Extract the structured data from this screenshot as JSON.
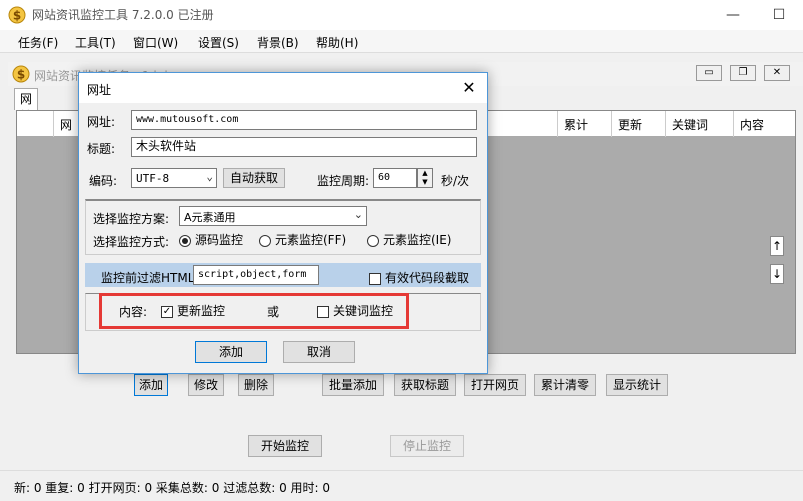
{
  "window": {
    "title": "网站资讯监控工具 7.2.0.0   已注册",
    "minimize": "—",
    "maximize": "☐"
  },
  "menu": [
    "任务(F)",
    "工具(T)",
    "窗口(W)",
    "设置(S)",
    "背景(B)",
    "帮助(H)"
  ],
  "child": {
    "title": "网站资讯监控任务 - 1.ini",
    "min": "▭",
    "restore": "❐",
    "close": "✕"
  },
  "tab": {
    "label": "网址管理"
  },
  "grid": {
    "columns": [
      "",
      "网",
      "",
      "累计",
      "更新",
      "关键词",
      "内容"
    ]
  },
  "scroll": {
    "up": "↑",
    "down": "↓"
  },
  "buttons": {
    "add": "添加",
    "edit": "修改",
    "delete": "删除",
    "batch_add": "批量添加",
    "get_title": "获取标题",
    "open_page": "打开网页",
    "clear_count": "累计清零",
    "show_stats": "显示统计",
    "start": "开始监控",
    "stop": "停止监控"
  },
  "status": "新: 0  重复: 0  打开网页: 0  采集总数: 0  过滤总数: 0  用时: 0",
  "dialog": {
    "title": "网址",
    "close": "✕",
    "url_label": "网址:",
    "url_value": "www.mutousoft.com",
    "title_label": "标题:",
    "title_value": "木头软件站",
    "encoding_label": "编码:",
    "encoding_value": "UTF-8",
    "auto_detect": "自动获取",
    "period_label": "监控周期:",
    "period_value": "60",
    "period_unit": "秒/次",
    "scheme_label": "选择监控方案:",
    "scheme_value": "A元素通用",
    "method_label": "选择监控方式:",
    "method_options": [
      "源码监控",
      "元素监控(FF)",
      "元素监控(IE)"
    ],
    "filter_label": "监控前过滤HTML",
    "filter_value": "script,object,form",
    "valid_code_label": "有效代码段截取",
    "content_label": "内容:",
    "update_monitor": "更新监控",
    "or": "或",
    "keyword_monitor": "关键词监控",
    "ok": "添加",
    "cancel": "取消"
  },
  "colors": {
    "accent": "#0078d7",
    "highlight": "#e53935",
    "filter_bg": "#b9d1ea"
  }
}
